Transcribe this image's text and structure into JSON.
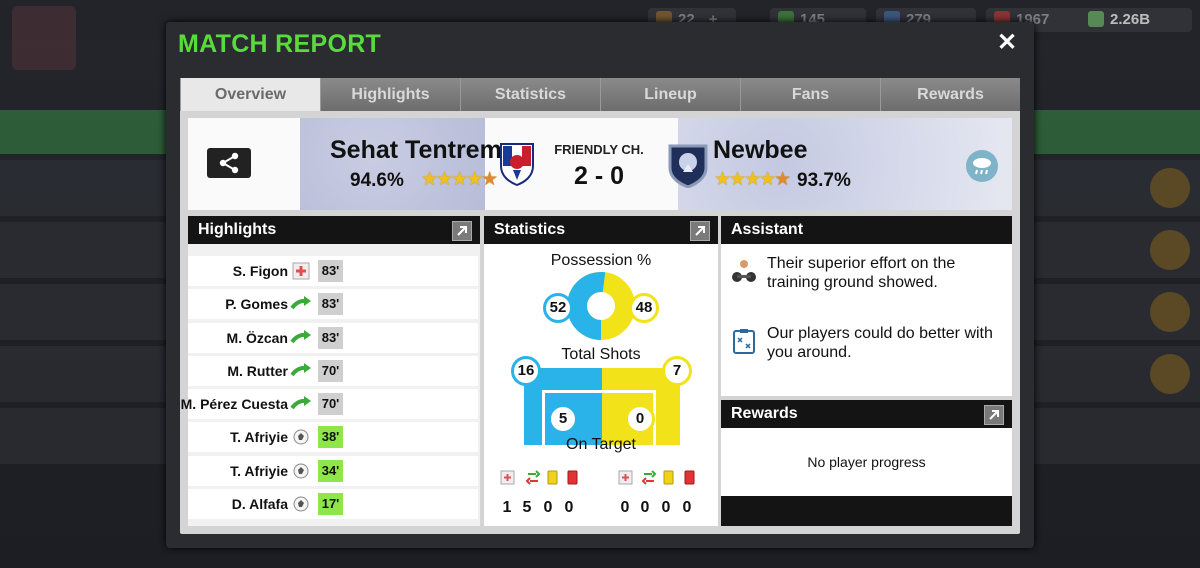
{
  "topbar": {
    "resources": [
      {
        "icon": "gem-icon",
        "value": "22",
        "color": "#8a6a3a"
      },
      {
        "icon": "token-icon",
        "value": "145",
        "color": "#4a8a4a"
      },
      {
        "icon": "bolt-icon",
        "value": "279",
        "color": "#4a6a9a"
      },
      {
        "icon": "medkit-icon",
        "value": "1967",
        "color": "#a84040"
      }
    ],
    "money": "2.26B"
  },
  "dialog": {
    "title": "MATCH REPORT",
    "close": "✕"
  },
  "tabs": [
    "Overview",
    "Highlights",
    "Statistics",
    "Lineup",
    "Fans",
    "Rewards"
  ],
  "active_tab": "Overview",
  "match": {
    "home_team": "Sehat Tentrem",
    "home_pct": "94.6%",
    "competition": "FRIENDLY CH.",
    "score": "2 - 0",
    "away_team": "Newbee",
    "away_pct": "93.7%",
    "home_stars": 4.5,
    "away_stars": 4.5,
    "weather_icon": "rain-cloud-icon"
  },
  "highlights": {
    "title": "Highlights",
    "events": [
      {
        "player": "S. Figon",
        "type": "injury-icon",
        "minute": "83'",
        "highlight": false
      },
      {
        "player": "P. Gomes",
        "type": "substitution-icon",
        "minute": "83'",
        "highlight": false
      },
      {
        "player": "M. Özcan",
        "type": "substitution-icon",
        "minute": "83'",
        "highlight": false
      },
      {
        "player": "M. Rutter",
        "type": "substitution-icon",
        "minute": "70'",
        "highlight": false
      },
      {
        "player": "M. Pérez Cuesta",
        "type": "substitution-icon",
        "minute": "70'",
        "highlight": false
      },
      {
        "player": "T. Afriyie",
        "type": "goal-ball-icon",
        "minute": "38'",
        "highlight": true
      },
      {
        "player": "T. Afriyie",
        "type": "goal-ball-icon",
        "minute": "34'",
        "highlight": true
      },
      {
        "player": "D. Alfafa",
        "type": "goal-ball-icon",
        "minute": "17'",
        "highlight": true
      }
    ]
  },
  "statistics": {
    "title": "Statistics",
    "possession_label": "Possession %",
    "possession": {
      "home": 52,
      "away": 48
    },
    "shots_label": "Total Shots",
    "shots": {
      "home": 16,
      "away": 7
    },
    "on_target_label": "On Target",
    "on_target": {
      "home": 5,
      "away": 0
    },
    "home_colors": {
      "primary": "#2ab3e8"
    },
    "away_colors": {
      "primary": "#f1e21a"
    },
    "home_counts": [
      "1",
      "5",
      "0",
      "0"
    ],
    "away_counts": [
      "0",
      "0",
      "0",
      "0"
    ]
  },
  "assistant": {
    "title": "Assistant",
    "items": [
      {
        "icon": "dumbbell-icon",
        "text": "Their superior effort on the training ground showed."
      },
      {
        "icon": "clipboard-tactics-icon",
        "text": "Our players could do better with you around."
      }
    ]
  },
  "rewards": {
    "title": "Rewards",
    "message": "No player progress"
  }
}
